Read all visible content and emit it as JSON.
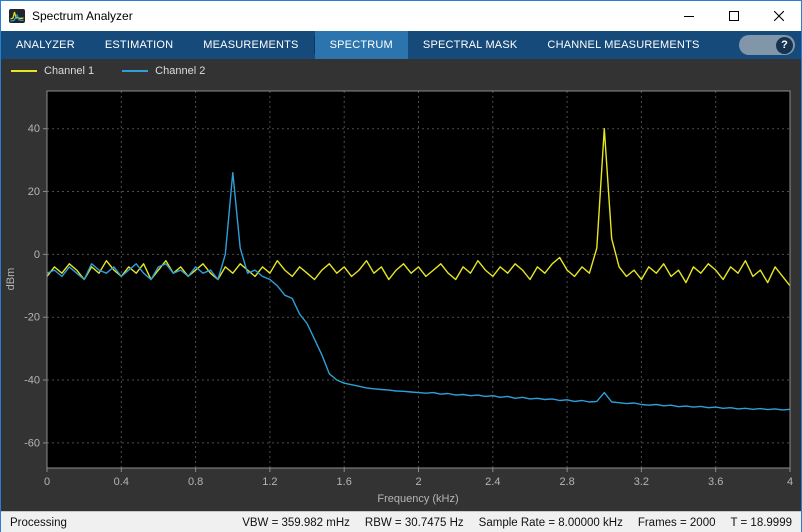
{
  "window": {
    "title": "Spectrum Analyzer",
    "icons": {
      "app": "spectrum-app",
      "minimize": "minimize",
      "maximize": "maximize",
      "close": "close"
    }
  },
  "toolstrip": {
    "tabs": [
      {
        "label": "ANALYZER",
        "selected": false
      },
      {
        "label": "ESTIMATION",
        "selected": false
      },
      {
        "label": "MEASUREMENTS",
        "selected": false
      },
      {
        "label": "SPECTRUM",
        "selected": true
      },
      {
        "label": "SPECTRAL MASK",
        "selected": false
      },
      {
        "label": "CHANNEL MEASUREMENTS",
        "selected": false
      }
    ],
    "help_label": "?"
  },
  "legend": {
    "items": [
      {
        "label": "Channel 1",
        "color": "#e6e622"
      },
      {
        "label": "Channel 2",
        "color": "#2e9fd9"
      }
    ]
  },
  "status_bar": {
    "state": "Processing",
    "vbw": "VBW = 359.982 mHz",
    "rbw": "RBW = 30.7475 Hz",
    "sample_rate": "Sample Rate = 8.00000 kHz",
    "frames": "Frames = 2000",
    "time": "T = 18.9999"
  },
  "chart_data": {
    "type": "line",
    "title": "",
    "xlabel": "Frequency (kHz)",
    "ylabel": "dBm",
    "xlim": [
      0,
      4
    ],
    "ylim": [
      -68,
      52
    ],
    "xticks": [
      0,
      0.4,
      0.8,
      1.2,
      1.6,
      2,
      2.4,
      2.8,
      3.2,
      3.6,
      4
    ],
    "xtick_labels": [
      "0",
      "0.4",
      "0.8",
      "1.2",
      "1.6",
      "2",
      "2.4",
      "2.8",
      "3.2",
      "3.6",
      "4"
    ],
    "yticks": [
      -60,
      -40,
      -20,
      0,
      20,
      40
    ],
    "ytick_labels": [
      "-60",
      "-40",
      "-20",
      "0",
      "20",
      "40"
    ],
    "grid": true,
    "legend_position": "top-left",
    "background": "#000000",
    "grid_color": "#4e4e4e",
    "box_color": "#8c8c8c",
    "tick_label_color": "#b5b5b5",
    "x": [
      0,
      0.04,
      0.08,
      0.12,
      0.16,
      0.2,
      0.24,
      0.28,
      0.32,
      0.36,
      0.4,
      0.44,
      0.48,
      0.52,
      0.56,
      0.6,
      0.64,
      0.68,
      0.72,
      0.76,
      0.8,
      0.84,
      0.88,
      0.92,
      0.96,
      1,
      1.04,
      1.08,
      1.12,
      1.16,
      1.2,
      1.24,
      1.28,
      1.32,
      1.36,
      1.4,
      1.44,
      1.48,
      1.52,
      1.56,
      1.6,
      1.64,
      1.68,
      1.72,
      1.76,
      1.8,
      1.84,
      1.88,
      1.92,
      1.96,
      2,
      2.04,
      2.08,
      2.12,
      2.16,
      2.2,
      2.24,
      2.28,
      2.32,
      2.36,
      2.4,
      2.44,
      2.48,
      2.52,
      2.56,
      2.6,
      2.64,
      2.68,
      2.72,
      2.76,
      2.8,
      2.84,
      2.88,
      2.92,
      2.96,
      3,
      3.04,
      3.08,
      3.12,
      3.16,
      3.2,
      3.24,
      3.28,
      3.32,
      3.36,
      3.4,
      3.44,
      3.48,
      3.52,
      3.56,
      3.6,
      3.64,
      3.68,
      3.72,
      3.76,
      3.8,
      3.84,
      3.88,
      3.92,
      3.96,
      4
    ],
    "series": [
      {
        "name": "Channel 1",
        "color": "#e6e622",
        "y": [
          -7,
          -4,
          -6,
          -3,
          -5,
          -8,
          -4,
          -6,
          -2,
          -5,
          -7,
          -4,
          -6,
          -3,
          -8,
          -5,
          -2,
          -6,
          -4,
          -7,
          -5,
          -3,
          -6,
          -8,
          -4,
          -6,
          -3,
          -5,
          -7,
          -4,
          -6,
          -2,
          -5,
          -7,
          -4,
          -6,
          -8,
          -5,
          -3,
          -6,
          -4,
          -7,
          -5,
          -2,
          -6,
          -4,
          -8,
          -5,
          -3,
          -6,
          -4,
          -7,
          -5,
          -3,
          -6,
          -8,
          -4,
          -6,
          -2,
          -5,
          -7,
          -4,
          -6,
          -3,
          -5,
          -8,
          -4,
          -6,
          -3,
          -1,
          -5,
          -7,
          -4,
          -6,
          2,
          40,
          5,
          -4,
          -7,
          -5,
          -8,
          -4,
          -6,
          -3,
          -7,
          -5,
          -9,
          -4,
          -6,
          -3,
          -5,
          -8,
          -4,
          -6,
          -2,
          -7,
          -5,
          -9,
          -4,
          -7,
          -10
        ]
      },
      {
        "name": "Channel 2",
        "color": "#2e9fd9",
        "y": [
          -6,
          -5,
          -7,
          -4,
          -6,
          -8,
          -3,
          -5,
          -6,
          -4,
          -7,
          -5,
          -3,
          -6,
          -8,
          -4,
          -3,
          -6,
          -5,
          -7,
          -4,
          -6,
          -5,
          -8,
          0,
          26,
          2,
          -6,
          -5,
          -7,
          -8,
          -10,
          -13,
          -14,
          -19,
          -22,
          -27,
          -32,
          -38,
          -40,
          -41,
          -41.5,
          -42,
          -42.5,
          -42.8,
          -43,
          -43.2,
          -43.5,
          -43.6,
          -43.8,
          -44,
          -44.2,
          -44,
          -44.5,
          -44.3,
          -44.8,
          -44.6,
          -45,
          -44.8,
          -45.2,
          -45,
          -45.5,
          -45.2,
          -45.8,
          -45.5,
          -46,
          -45.8,
          -46.2,
          -46,
          -46.5,
          -46.3,
          -46.8,
          -46.5,
          -47,
          -46.8,
          -44,
          -47,
          -47.2,
          -47.5,
          -47.3,
          -47.8,
          -48,
          -47.8,
          -48.2,
          -48,
          -48.5,
          -48.3,
          -48.6,
          -48.4,
          -48.8,
          -48.6,
          -49,
          -48.8,
          -49.2,
          -49,
          -49.3,
          -49.1,
          -49.4,
          -49.2,
          -49.5,
          -49.3
        ]
      }
    ]
  }
}
